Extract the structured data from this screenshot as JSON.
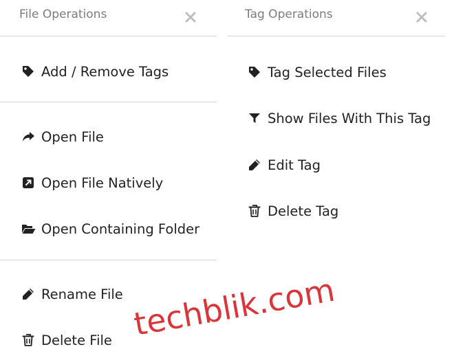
{
  "file_operations": {
    "title": "File Operations",
    "close_icon": "close-icon",
    "groups": [
      [
        {
          "label": "Add / Remove Tags",
          "icon": "tag-icon"
        }
      ],
      [
        {
          "label": "Open File",
          "icon": "share-arrow-icon"
        },
        {
          "label": "Open File Natively",
          "icon": "external-link-square-icon"
        },
        {
          "label": "Open Containing Folder",
          "icon": "folder-open-icon"
        }
      ],
      [
        {
          "label": "Rename File",
          "icon": "pencil-icon"
        },
        {
          "label": "Delete File",
          "icon": "trash-icon"
        }
      ]
    ]
  },
  "tag_operations": {
    "title": "Tag Operations",
    "close_icon": "close-icon",
    "items": [
      {
        "label": "Tag Selected Files",
        "icon": "tag-icon"
      },
      {
        "label": "Show Files With This Tag",
        "icon": "filter-icon"
      },
      {
        "label": "Edit Tag",
        "icon": "pencil-icon"
      },
      {
        "label": "Delete Tag",
        "icon": "trash-icon"
      }
    ]
  },
  "watermark": {
    "text": "techblik.com",
    "color": "#d8363a"
  },
  "colors": {
    "title": "#7c7c7c",
    "text": "#222222",
    "divider": "#d4d4d4",
    "close": "#bdbdbd"
  }
}
